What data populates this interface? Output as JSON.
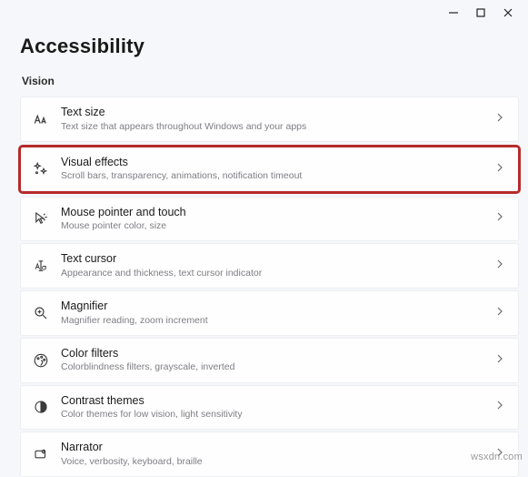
{
  "page": {
    "title": "Accessibility",
    "section": "Vision"
  },
  "items": [
    {
      "title": "Text size",
      "desc": "Text size that appears throughout Windows and your apps",
      "highlight": false
    },
    {
      "title": "Visual effects",
      "desc": "Scroll bars, transparency, animations, notification timeout",
      "highlight": true
    },
    {
      "title": "Mouse pointer and touch",
      "desc": "Mouse pointer color, size",
      "highlight": false
    },
    {
      "title": "Text cursor",
      "desc": "Appearance and thickness, text cursor indicator",
      "highlight": false
    },
    {
      "title": "Magnifier",
      "desc": "Magnifier reading, zoom increment",
      "highlight": false
    },
    {
      "title": "Color filters",
      "desc": "Colorblindness filters, grayscale, inverted",
      "highlight": false
    },
    {
      "title": "Contrast themes",
      "desc": "Color themes for low vision, light sensitivity",
      "highlight": false
    },
    {
      "title": "Narrator",
      "desc": "Voice, verbosity, keyboard, braille",
      "highlight": false
    }
  ],
  "watermark": "wsxdn.com"
}
